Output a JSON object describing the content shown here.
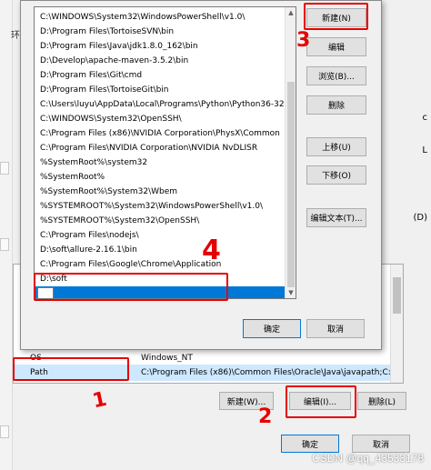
{
  "dialog": {
    "paths": [
      "C:\\WINDOWS\\System32\\WindowsPowerShell\\v1.0\\",
      "D:\\Program Files\\TortoiseSVN\\bin",
      "D:\\Program Files\\Java\\jdk1.8.0_162\\bin",
      "D:\\Develop\\apache-maven-3.5.2\\bin",
      "D:\\Program Files\\Git\\cmd",
      "D:\\Program Files\\TortoiseGit\\bin",
      "C:\\Users\\luyu\\AppData\\Local\\Programs\\Python\\Python36-32...",
      "C:\\WINDOWS\\System32\\OpenSSH\\",
      "C:\\Program Files (x86)\\NVIDIA Corporation\\PhysX\\Common",
      "C:\\Program Files\\NVIDIA Corporation\\NVIDIA NvDLISR",
      "%SystemRoot%\\system32",
      "%SystemRoot%",
      "%SystemRoot%\\System32\\Wbem",
      "%SYSTEMROOT%\\System32\\WindowsPowerShell\\v1.0\\",
      "%SYSTEMROOT%\\System32\\OpenSSH\\",
      "C:\\Program Files\\nodejs\\",
      "D:\\soft\\allure-2.16.1\\bin",
      "C:\\Program Files\\Google\\Chrome\\Application",
      "D:\\soft"
    ],
    "new_button": "新建(N)",
    "edit_button": "编辑",
    "browse_button": "浏览(B)...",
    "delete_button": "删除",
    "move_up_button": "上移(U)",
    "move_down_button": "下移(O)",
    "edit_text_button": "编辑文本(T)...",
    "ok_button": "确定",
    "cancel_button": "取消"
  },
  "background": {
    "title_fragment": "环",
    "right_fragment_1": "(D)",
    "right_fragment_2": "c",
    "right_fragment_3": "L",
    "rows": [
      {
        "name": "OS",
        "value": "Windows_NT"
      },
      {
        "name": "Path",
        "value": "C:\\Program Files (x86)\\Common Files\\Oracle\\Java\\javapath;C:..."
      }
    ],
    "new_button": "新建(W)...",
    "edit_button": "编辑(I)...",
    "delete_button": "删除(L)",
    "ok_button": "确定",
    "cancel_button": "取消"
  },
  "annotations": {
    "n1": "1",
    "n2": "2",
    "n3": "3",
    "n4": "4"
  },
  "watermark": "CSDN @qq_43533178",
  "colors": {
    "selection": "#0078d7",
    "annotation": "#e60000",
    "dialog_bg": "#f0f0f0"
  }
}
